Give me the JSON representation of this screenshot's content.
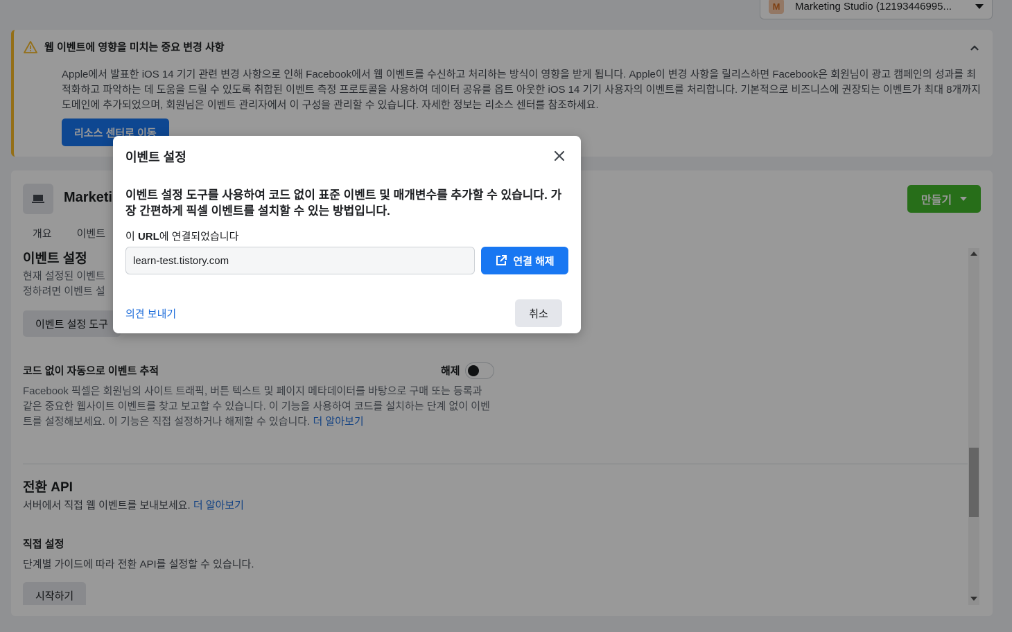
{
  "account": {
    "avatar_letter": "M",
    "name": "Marketing Studio (12193446995..."
  },
  "banner": {
    "title": "웹 이벤트에 영향을 미치는 중요 변경 사항",
    "body": "Apple에서 발표한 iOS 14 기기 관련 변경 사항으로 인해 Facebook에서 웹 이벤트를 수신하고 처리하는 방식이 영향을 받게 됩니다. Apple이 변경 사항을 릴리스하면 Facebook은 회원님이 광고 캠페인의 성과를 최적화하고 파악하는 데 도움을 드릴 수 있도록 취합된 이벤트 측정 프로토콜을 사용하여 데이터 공유를 옵트 아웃한 iOS 14 기기 사용자의 이벤트를 처리합니다. 기본적으로 비즈니스에 권장되는 이벤트가 최대 8개까지 도메인에 추가되었으며, 회원님은 이벤트 관리자에서 이 구성을 관리할 수 있습니다. 자세한 정보는 리소스 센터를 참조하세요.",
    "button": "리소스 센터로 이동"
  },
  "pixel": {
    "name": "Marketi",
    "create_button": "만들기",
    "tabs": [
      "개요",
      "이벤트"
    ]
  },
  "event_setup": {
    "title": "이벤트 설정",
    "desc_line1": "현재 설정된 이벤트",
    "desc_line2": "정하려면 이벤트 설",
    "button": "이벤트 설정 도구"
  },
  "auto_tracking": {
    "title": "코드 없이 자동으로 이벤트 추적",
    "toggle_label": "해제",
    "desc": "Facebook 픽셀은 회원님의 사이트 트래픽, 버튼 텍스트 및 페이지 메타데이터를 바탕으로 구매 또는 등록과 같은 중요한 웹사이트 이벤트를 찾고 보고할 수 있습니다. 이 기능을 사용하여 코드를 설치하는 단계 없이 이벤트를 설정해보세요. 이 기능은 직접 설정하거나 해제할 수 있습니다.",
    "link": "더 알아보기"
  },
  "conversions_api": {
    "title": "전환 API",
    "desc": "서버에서 직접 웹 이벤트를 보내보세요.",
    "link": "더 알아보기",
    "manual_title": "직접 설정",
    "manual_desc": "단계별 가이드에 따라 전환 API를 설정할 수 있습니다.",
    "start_button": "시작하기"
  },
  "modal": {
    "title": "이벤트 설정",
    "headline": "이벤트 설정 도구를 사용하여 코드 없이 표준 이벤트 및 매개변수를 추가할 수 있습니다. 가장 간편하게 픽셀 이벤트를 설치할 수 있는 방법입니다.",
    "url_label_prefix": "이 ",
    "url_label_bold": "URL",
    "url_label_suffix": "에 연결되었습니다",
    "url_value": "learn-test.tistory.com",
    "disconnect_button": "연결 해제",
    "feedback_link": "의견 보내기",
    "cancel_button": "취소"
  },
  "colors": {
    "primary": "#1877f2",
    "create": "#42b72a",
    "warning": "#f7b928",
    "link": "#216fdb"
  }
}
